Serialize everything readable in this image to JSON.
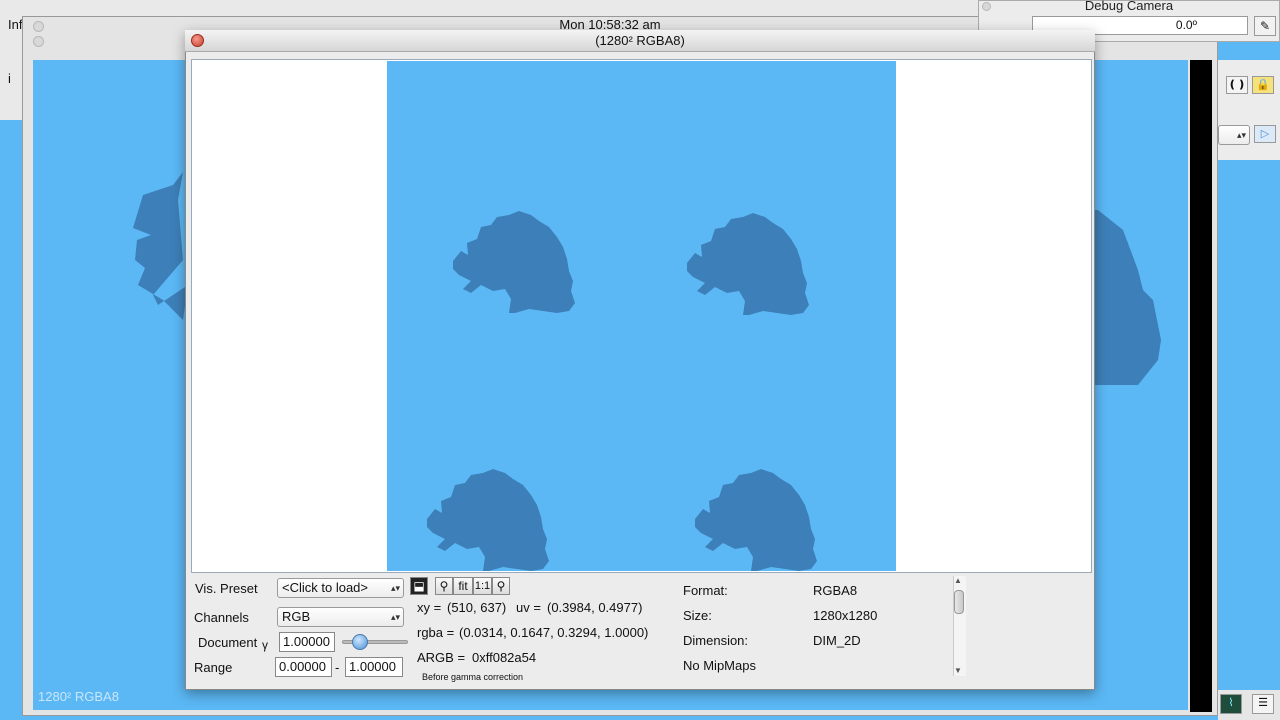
{
  "desktop": {
    "clock": "Mon 10:58:32 am",
    "left_window_fragment": "Inf",
    "left_window_fragment2": "i",
    "background_window_label": "1280² RGBA8"
  },
  "debug_camera": {
    "title": "Debug Camera",
    "field_value": "0.0º"
  },
  "window": {
    "title": "(1280² RGBA8)"
  },
  "controls": {
    "vis_preset_label": "Vis. Preset",
    "vis_preset_value": "<Click to load>",
    "channels_label": "Channels",
    "channels_value": "RGB",
    "document_label": "Document",
    "gamma_symbol": "γ",
    "gamma_value": "1.00000",
    "gamma_slider_level": 0.2,
    "range_label": "Range",
    "range_min": "0.00000",
    "range_separator": "-",
    "range_max": "1.00000",
    "toolbar": {
      "fit": "fit",
      "one_to_one": "1:1"
    }
  },
  "pixel_info": {
    "xy_label": "xy =",
    "xy_value": "(510, 637)",
    "uv_label": "uv =",
    "uv_value": "(0.3984, 0.4977)",
    "rgba_label": "rgba =",
    "rgba_value": "(0.0314, 0.1647, 0.3294, 1.0000)",
    "argb_label": "ARGB =",
    "argb_value": "0xff082a54",
    "note": "Before gamma correction"
  },
  "texture_info": {
    "format_label": "Format:",
    "format_value": "RGBA8",
    "size_label": "Size:",
    "size_value": "1280x1280",
    "dimension_label": "Dimension:",
    "dimension_value": "DIM_2D",
    "mipmaps": "No MipMaps"
  },
  "colors": {
    "texture_background": "#5bb8f5",
    "tree_color": "#3d7fb8",
    "close_button": "#d2503c"
  }
}
